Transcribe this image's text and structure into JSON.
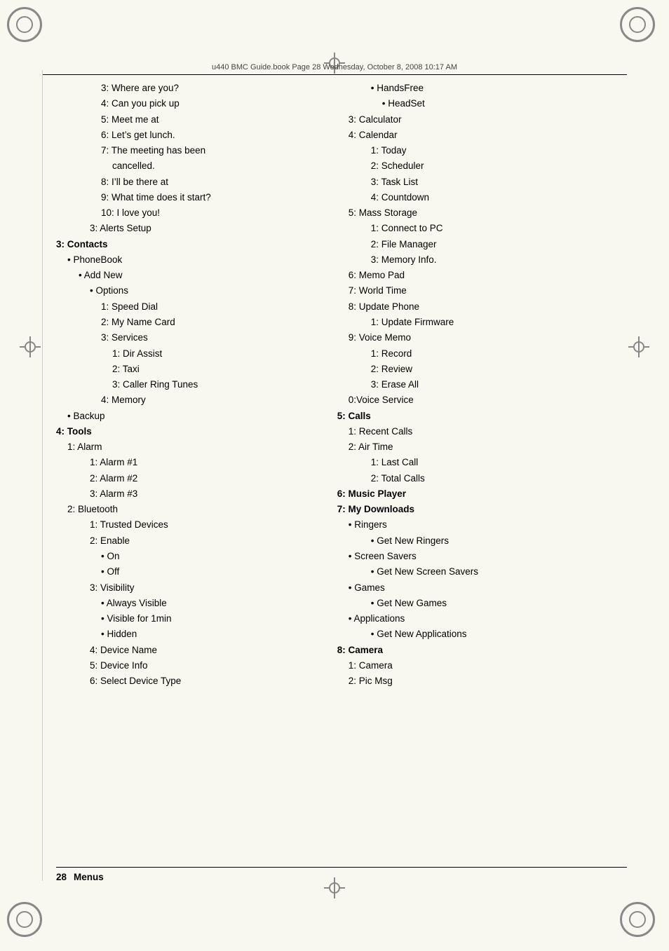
{
  "header": {
    "text": "u440 BMC Guide.book  Page 28  Wednesday, October 8, 2008  10:17 AM"
  },
  "footer": {
    "page_number": "28",
    "section": "Menus"
  },
  "left_column": {
    "lines": [
      {
        "indent": 4,
        "text": "3: Where are you?",
        "bold": false
      },
      {
        "indent": 4,
        "text": "4: Can you pick up",
        "bold": false
      },
      {
        "indent": 4,
        "text": "5: Meet me at",
        "bold": false
      },
      {
        "indent": 4,
        "text": "6: Let’s get lunch.",
        "bold": false
      },
      {
        "indent": 4,
        "text": "7: The meeting has been",
        "bold": false
      },
      {
        "indent": 5,
        "text": "cancelled.",
        "bold": false
      },
      {
        "indent": 4,
        "text": "8: I’ll be there at",
        "bold": false
      },
      {
        "indent": 4,
        "text": "9: What time does it start?",
        "bold": false
      },
      {
        "indent": 4,
        "text": "10: I love you!",
        "bold": false
      },
      {
        "indent": 3,
        "text": "3: Alerts Setup",
        "bold": false
      },
      {
        "indent": 0,
        "text": "3: Contacts",
        "bold": true
      },
      {
        "indent": 1,
        "bullet": true,
        "text": "PhoneBook",
        "bold": false
      },
      {
        "indent": 2,
        "bullet": true,
        "text": "Add New",
        "bold": false
      },
      {
        "indent": 3,
        "bullet": true,
        "text": "Options",
        "bold": false
      },
      {
        "indent": 4,
        "text": "1: Speed Dial",
        "bold": false
      },
      {
        "indent": 4,
        "text": "2: My Name Card",
        "bold": false
      },
      {
        "indent": 4,
        "text": "3: Services",
        "bold": false
      },
      {
        "indent": 5,
        "text": "1: Dir Assist",
        "bold": false
      },
      {
        "indent": 5,
        "text": "2: Taxi",
        "bold": false
      },
      {
        "indent": 5,
        "text": "3: Caller Ring Tunes",
        "bold": false
      },
      {
        "indent": 4,
        "text": "4: Memory",
        "bold": false
      },
      {
        "indent": 1,
        "bullet": true,
        "text": "Backup",
        "bold": false
      },
      {
        "indent": 0,
        "text": "4: Tools",
        "bold": true
      },
      {
        "indent": 1,
        "text": "1: Alarm",
        "bold": false
      },
      {
        "indent": 3,
        "text": "1: Alarm #1",
        "bold": false
      },
      {
        "indent": 3,
        "text": "2: Alarm #2",
        "bold": false
      },
      {
        "indent": 3,
        "text": "3: Alarm #3",
        "bold": false
      },
      {
        "indent": 1,
        "text": "2: Bluetooth",
        "bold": false
      },
      {
        "indent": 3,
        "text": "1: Trusted Devices",
        "bold": false
      },
      {
        "indent": 3,
        "text": "2: Enable",
        "bold": false
      },
      {
        "indent": 4,
        "bullet": true,
        "text": "On",
        "bold": false
      },
      {
        "indent": 4,
        "bullet": true,
        "text": "Off",
        "bold": false
      },
      {
        "indent": 3,
        "text": "3: Visibility",
        "bold": false
      },
      {
        "indent": 4,
        "bullet": true,
        "text": "Always Visible",
        "bold": false
      },
      {
        "indent": 4,
        "bullet": true,
        "text": "Visible for 1min",
        "bold": false
      },
      {
        "indent": 4,
        "bullet": true,
        "text": "Hidden",
        "bold": false
      },
      {
        "indent": 3,
        "text": "4: Device Name",
        "bold": false
      },
      {
        "indent": 3,
        "text": "5: Device Info",
        "bold": false
      },
      {
        "indent": 3,
        "text": "6: Select Device Type",
        "bold": false
      }
    ]
  },
  "right_column": {
    "lines": [
      {
        "indent": 3,
        "bullet": true,
        "text": "HandsFree",
        "bold": false
      },
      {
        "indent": 4,
        "bullet": true,
        "text": "HeadSet",
        "bold": false
      },
      {
        "indent": 1,
        "text": "3: Calculator",
        "bold": false
      },
      {
        "indent": 1,
        "text": "4: Calendar",
        "bold": false
      },
      {
        "indent": 3,
        "text": "1: Today",
        "bold": false
      },
      {
        "indent": 3,
        "text": "2: Scheduler",
        "bold": false
      },
      {
        "indent": 3,
        "text": "3: Task List",
        "bold": false
      },
      {
        "indent": 3,
        "text": "4: Countdown",
        "bold": false
      },
      {
        "indent": 1,
        "text": "5: Mass Storage",
        "bold": false
      },
      {
        "indent": 3,
        "text": "1: Connect to PC",
        "bold": false
      },
      {
        "indent": 3,
        "text": "2: File Manager",
        "bold": false
      },
      {
        "indent": 3,
        "text": "3: Memory Info.",
        "bold": false
      },
      {
        "indent": 1,
        "text": "6: Memo Pad",
        "bold": false
      },
      {
        "indent": 1,
        "text": "7: World Time",
        "bold": false
      },
      {
        "indent": 1,
        "text": "8: Update Phone",
        "bold": false
      },
      {
        "indent": 3,
        "text": "1: Update Firmware",
        "bold": false
      },
      {
        "indent": 1,
        "text": "9: Voice Memo",
        "bold": false
      },
      {
        "indent": 3,
        "text": "1: Record",
        "bold": false
      },
      {
        "indent": 3,
        "text": "2: Review",
        "bold": false
      },
      {
        "indent": 3,
        "text": "3: Erase All",
        "bold": false
      },
      {
        "indent": 1,
        "text": "0:Voice Service",
        "bold": false
      },
      {
        "indent": 0,
        "text": "5: Calls",
        "bold": true
      },
      {
        "indent": 1,
        "text": "1: Recent Calls",
        "bold": false
      },
      {
        "indent": 1,
        "text": "2: Air Time",
        "bold": false
      },
      {
        "indent": 3,
        "text": "1: Last Call",
        "bold": false
      },
      {
        "indent": 3,
        "text": "2: Total Calls",
        "bold": false
      },
      {
        "indent": 0,
        "text": "6: Music Player",
        "bold": true
      },
      {
        "indent": 0,
        "text": "7: My Downloads",
        "bold": true
      },
      {
        "indent": 1,
        "bullet": true,
        "text": "Ringers",
        "bold": false
      },
      {
        "indent": 3,
        "bullet": true,
        "text": "Get New Ringers",
        "bold": false
      },
      {
        "indent": 1,
        "bullet": true,
        "text": "Screen Savers",
        "bold": false
      },
      {
        "indent": 3,
        "bullet": true,
        "text": "Get New Screen Savers",
        "bold": false
      },
      {
        "indent": 1,
        "bullet": true,
        "text": "Games",
        "bold": false
      },
      {
        "indent": 3,
        "bullet": true,
        "text": "Get New Games",
        "bold": false
      },
      {
        "indent": 1,
        "bullet": true,
        "text": "Applications",
        "bold": false
      },
      {
        "indent": 3,
        "bullet": true,
        "text": "Get New Applications",
        "bold": false
      },
      {
        "indent": 0,
        "text": "8: Camera",
        "bold": true
      },
      {
        "indent": 1,
        "text": "1: Camera",
        "bold": false
      },
      {
        "indent": 1,
        "text": "2: Pic Msg",
        "bold": false
      }
    ]
  }
}
